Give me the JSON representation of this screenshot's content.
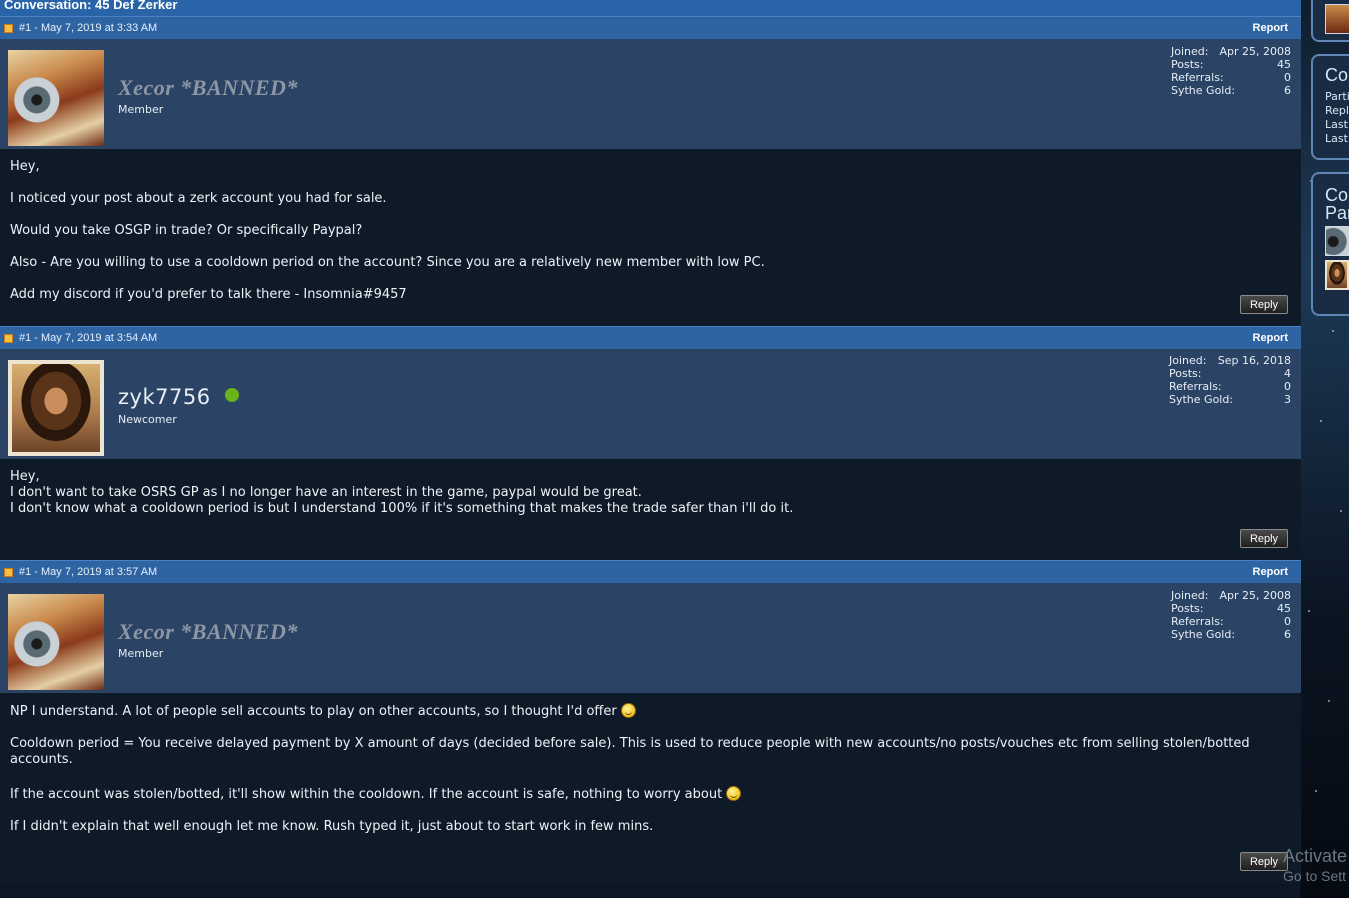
{
  "conversation_title": "Conversation: 45 Def Zerker",
  "posts": [
    {
      "meta": "#1 - May 7, 2019 at 3:33 AM",
      "report_label": "Report",
      "username": "Xecor *BANNED*",
      "user_title": "Member",
      "stats": {
        "joined_label": "Joined:",
        "joined_value": "Apr 25, 2008",
        "posts_label": "Posts:",
        "posts_value": "45",
        "referrals_label": "Referrals:",
        "referrals_value": "0",
        "gold_label": "Sythe Gold:",
        "gold_value": "6"
      },
      "body": [
        "Hey,",
        "I noticed your post about a zerk account you had for sale.",
        "Would you take OSGP in trade? Or specifically Paypal?",
        "Also - Are you willing to use a cooldown period on the account? Since you are a relatively new member with low PC.",
        "Add my discord if you'd prefer to talk there - Insomnia#9457"
      ],
      "reply_label": "Reply"
    },
    {
      "meta": "#1 - May 7, 2019 at 3:54 AM",
      "report_label": "Report",
      "username": "zyk7756",
      "user_title": "Newcomer",
      "stats": {
        "joined_label": "Joined:",
        "joined_value": "Sep 16, 2018",
        "posts_label": "Posts:",
        "posts_value": "4",
        "referrals_label": "Referrals:",
        "referrals_value": "0",
        "gold_label": "Sythe Gold:",
        "gold_value": "3"
      },
      "body": [
        "Hey,",
        "I don't want to take OSRS GP as I no longer have an interest in the game, paypal would be great.",
        "I don't know what a cooldown period is but I understand 100% if it's something that makes the trade safer than i'll do it."
      ],
      "reply_label": "Reply"
    },
    {
      "meta": "#1 - May 7, 2019 at 3:57 AM",
      "report_label": "Report",
      "username": "Xecor *BANNED*",
      "user_title": "Member",
      "stats": {
        "joined_label": "Joined:",
        "joined_value": "Apr 25, 2008",
        "posts_label": "Posts:",
        "posts_value": "45",
        "referrals_label": "Referrals:",
        "referrals_value": "0",
        "gold_label": "Sythe Gold:",
        "gold_value": "6"
      },
      "body": [
        "NP I understand. A lot of people sell accounts to play on other accounts, so I thought I'd offer",
        "Cooldown period = You receive delayed payment by X amount of days (decided before sale). This is used to reduce people with new accounts/no posts/vouches etc from selling stolen/botted accounts.",
        "If the account was stolen/botted, it'll show within the cooldown. If the account is safe, nothing to worry about",
        "If I didn't explain that well enough let me know. Rush typed it, just about to start work in few mins."
      ],
      "reply_label": "Reply"
    }
  ],
  "sidebar": {
    "widget1": {
      "head": "Co",
      "lines": [
        "Parti",
        "Repl",
        "Last",
        "Last"
      ]
    },
    "widget2": {
      "head1": "Co",
      "head2": "Par"
    }
  },
  "watermark": {
    "line1": "Activate",
    "line2": "Go to Sett"
  },
  "icons": {
    "post_icon": "post-icon",
    "online_status": "online-status-icon",
    "smiley": "smiley-icon"
  },
  "colors": {
    "header_bar": "#2f64a3",
    "user_panel": "#2b4465",
    "body_bg": "#0f1a29",
    "online_green": "#6ab31b"
  }
}
